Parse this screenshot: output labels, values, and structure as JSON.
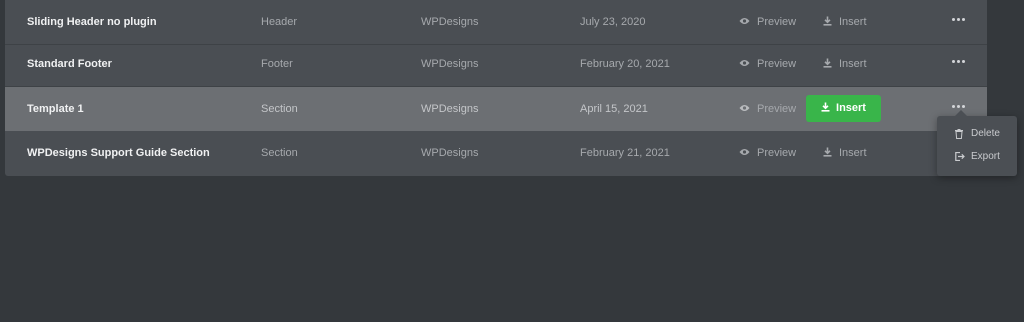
{
  "templates": [
    {
      "title": "Sliding Header no plugin",
      "type": "Header",
      "author": "WPDesigns",
      "date": "July 23, 2020",
      "preview_label": "Preview",
      "insert_label": "Insert"
    },
    {
      "title": "Standard Footer",
      "type": "Footer",
      "author": "WPDesigns",
      "date": "February 20, 2021",
      "preview_label": "Preview",
      "insert_label": "Insert"
    },
    {
      "title": "Template 1",
      "type": "Section",
      "author": "WPDesigns",
      "date": "April 15, 2021",
      "preview_label": "Preview",
      "insert_label": "Insert"
    },
    {
      "title": "WPDesigns Support Guide Section",
      "type": "Section",
      "author": "WPDesigns",
      "date": "February 21, 2021",
      "preview_label": "Preview",
      "insert_label": "Insert"
    }
  ],
  "active_row_index": 2,
  "context_menu": {
    "items": [
      {
        "label": "Delete",
        "icon": "trash-icon"
      },
      {
        "label": "Export",
        "icon": "export-icon"
      }
    ]
  },
  "colors": {
    "page_background": "#34383c",
    "panel_background": "#4a4e53",
    "active_row": "#6c6f73",
    "insert_button": "#39b54a"
  }
}
